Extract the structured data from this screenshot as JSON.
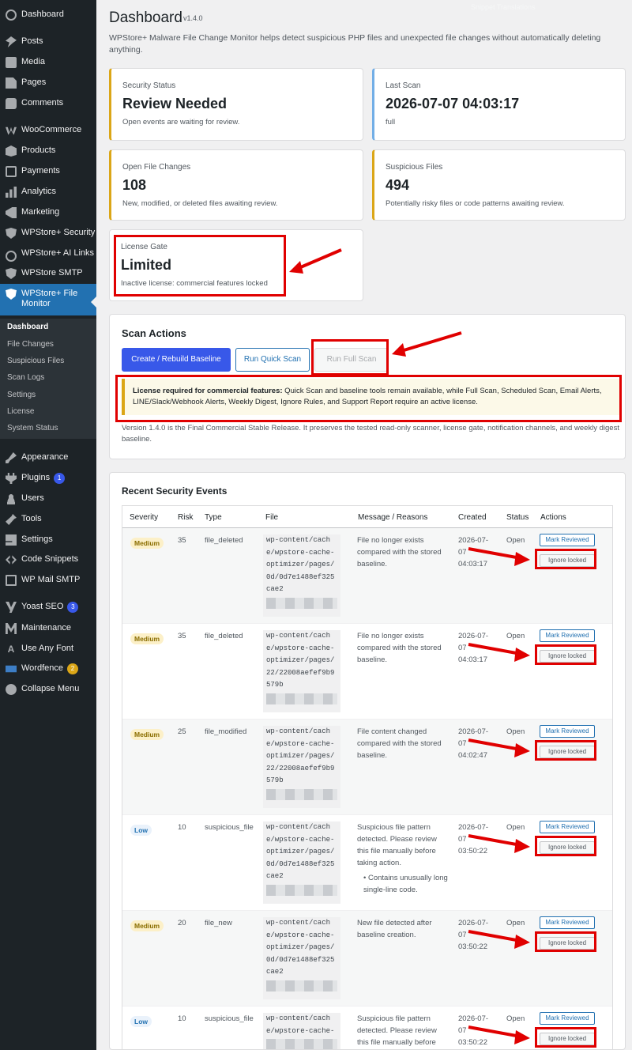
{
  "sidebar": {
    "items": [
      {
        "label": "Dashboard",
        "icon": "dashboard-icon"
      },
      {
        "label": "Posts",
        "icon": "pin-icon"
      },
      {
        "label": "Media",
        "icon": "media-icon"
      },
      {
        "label": "Pages",
        "icon": "page-icon"
      },
      {
        "label": "Comments",
        "icon": "comment-icon"
      },
      {
        "label": "WooCommerce",
        "icon": "woocommerce-icon"
      },
      {
        "label": "Products",
        "icon": "box-icon"
      },
      {
        "label": "Payments",
        "icon": "payment-icon"
      },
      {
        "label": "Analytics",
        "icon": "bar-chart-icon"
      },
      {
        "label": "Marketing",
        "icon": "megaphone-icon"
      },
      {
        "label": "WPStore+ Security",
        "icon": "shield-icon"
      },
      {
        "label": "WPStore+ AI Links",
        "icon": "link-icon"
      },
      {
        "label": "WPStore SMTP",
        "icon": "shield-icon"
      },
      {
        "label": "WPStore+ File Monitor",
        "icon": "shield-icon"
      }
    ],
    "submenu": [
      "Dashboard",
      "File Changes",
      "Suspicious Files",
      "Scan Logs",
      "Settings",
      "License",
      "System Status"
    ],
    "items_lower": [
      {
        "label": "Appearance",
        "icon": "brush-icon"
      },
      {
        "label": "Plugins",
        "icon": "plugin-icon",
        "badge": "1"
      },
      {
        "label": "Users",
        "icon": "user-icon"
      },
      {
        "label": "Tools",
        "icon": "wrench-icon"
      },
      {
        "label": "Settings",
        "icon": "settings-icon"
      },
      {
        "label": "Code Snippets",
        "icon": "code-icon"
      },
      {
        "label": "WP Mail SMTP",
        "icon": "mail-icon"
      },
      {
        "label": "Yoast SEO",
        "icon": "yoast-icon",
        "badge": "3"
      },
      {
        "label": "Maintenance",
        "icon": "maintenance-icon"
      },
      {
        "label": "Use Any Font",
        "icon": "font-icon"
      },
      {
        "label": "Wordfence",
        "icon": "wordfence-icon",
        "badge": "2"
      },
      {
        "label": "Collapse Menu",
        "icon": "collapse-icon"
      }
    ]
  },
  "header": {
    "title": "Dashboard",
    "version": "v1.4.0",
    "screen_options": "Snippet Translations",
    "description": "WPStore+ Malware File Change Monitor helps detect suspicious PHP files and unexpected file changes without automatically deleting anything."
  },
  "cards": [
    {
      "label": "Security Status",
      "value": "Review Needed",
      "sub": "Open events are waiting for review."
    },
    {
      "label": "Last Scan",
      "value": "2026-07-07 04:03:17",
      "sub": "full"
    },
    {
      "label": "Open File Changes",
      "value": "108",
      "sub": "New, modified, or deleted files awaiting review."
    },
    {
      "label": "Suspicious Files",
      "value": "494",
      "sub": "Potentially risky files or code patterns awaiting review."
    },
    {
      "label": "License Gate",
      "value": "Limited",
      "sub": "Inactive license: commercial features locked"
    }
  ],
  "scan": {
    "title": "Scan Actions",
    "btn_rebuild": "Create / Rebuild Baseline",
    "btn_quick": "Run Quick Scan",
    "btn_full": "Run Full Scan",
    "notice_strong": "License required for commercial features:",
    "notice_text": " Quick Scan and baseline tools remain available, while Full Scan, Scheduled Scan, Email Alerts, LINE/Slack/Webhook Alerts, Weekly Digest, Ignore Rules, and Support Report require an active license.",
    "release_note": "Version 1.4.0 is the Final Commercial Stable Release. It preserves the tested read-only scanner, license gate, notification channels, and weekly digest baseline."
  },
  "events": {
    "title": "Recent Security Events",
    "columns": [
      "Severity",
      "Risk",
      "Type",
      "File",
      "Message / Reasons",
      "Created",
      "Status",
      "Actions"
    ],
    "mark_reviewed": "Mark Reviewed",
    "ignore_locked": "Ignore locked",
    "rows": [
      {
        "severity": "Medium",
        "sev_class": "medium",
        "risk": "35",
        "type": "file_deleted",
        "file": "wp-content/cache/wpstore-cache-optimizer/pages/0d/0d7e1488ef325cae2",
        "message": "File no longer exists compared with the stored baseline.",
        "created": "2026-07-07 04:03:17",
        "status": "Open"
      },
      {
        "severity": "Medium",
        "sev_class": "medium",
        "risk": "35",
        "type": "file_deleted",
        "file": "wp-content/cache/wpstore-cache-optimizer/pages/22/22008aefef9b9579b",
        "message": "File no longer exists compared with the stored baseline.",
        "created": "2026-07-07 04:03:17",
        "status": "Open"
      },
      {
        "severity": "Medium",
        "sev_class": "medium",
        "risk": "25",
        "type": "file_modified",
        "file": "wp-content/cache/wpstore-cache-optimizer/pages/22/22008aefef9b9579b",
        "message": "File content changed compared with the stored baseline.",
        "created": "2026-07-07 04:02:47",
        "status": "Open"
      },
      {
        "severity": "Low",
        "sev_class": "low",
        "risk": "10",
        "type": "suspicious_file",
        "file": "wp-content/cache/wpstore-cache-optimizer/pages/0d/0d7e1488ef325cae2",
        "message": "Suspicious file pattern detected. Please review this file manually before taking action.",
        "bullet": "Contains unusually long single-line code.",
        "created": "2026-07-07 03:50:22",
        "status": "Open"
      },
      {
        "severity": "Medium",
        "sev_class": "medium",
        "risk": "20",
        "type": "file_new",
        "file": "wp-content/cache/wpstore-cache-optimizer/pages/0d/0d7e1488ef325cae2",
        "message": "New file detected after baseline creation.",
        "created": "2026-07-07 03:50:22",
        "status": "Open"
      },
      {
        "severity": "Low",
        "sev_class": "low",
        "risk": "10",
        "type": "suspicious_file",
        "file": "wp-content/cache/wpstore-cache-",
        "message": "Suspicious file pattern detected. Please review this file manually before",
        "created": "2026-07-07 03:50:22",
        "status": "Open"
      }
    ]
  },
  "colors": {
    "accent": "#3858e9",
    "annotation_red": "#e00000",
    "warning": "#dba617",
    "sidebar_bg": "#1d2327",
    "current_menu": "#2271b1"
  }
}
